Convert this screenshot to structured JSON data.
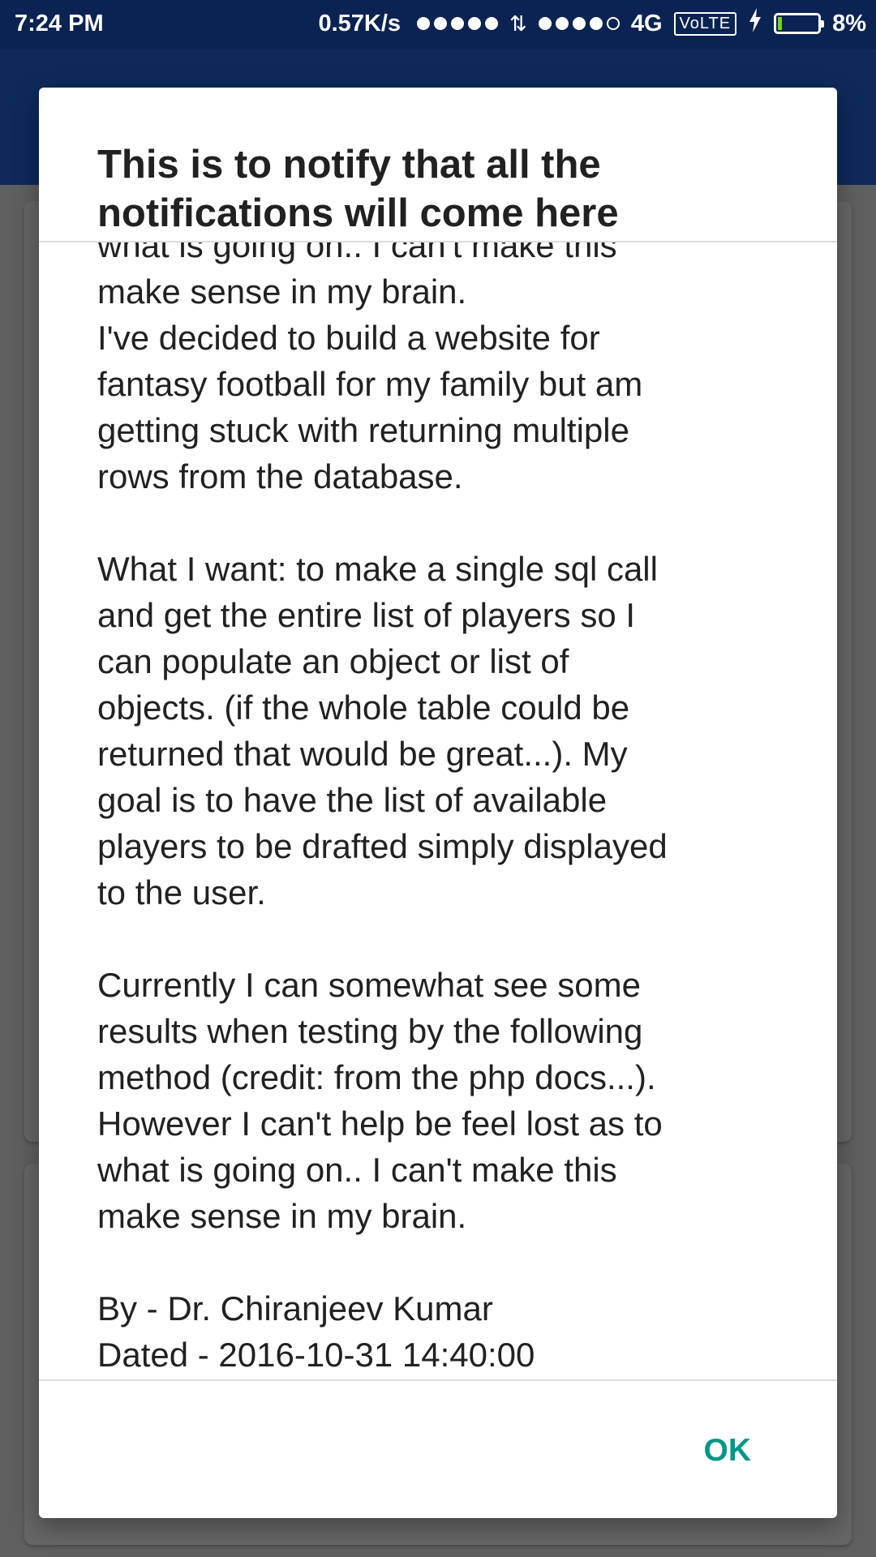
{
  "status_bar": {
    "time": "7:24 PM",
    "net_speed": "0.57K/s",
    "network_type": "4G",
    "volte": "VoLTE",
    "battery_percent": "8%",
    "signal_icon": "signal-dots-icon",
    "battery_icon": "battery-charging-icon"
  },
  "dialog": {
    "title": "This is to notify that all the notifications will come here",
    "body": "what is going on.. I can't make this\nmake sense in my brain.\nI've decided to build a website for\nfantasy football for my family but am\ngetting stuck with returning multiple\nrows from the database.\n\nWhat I want: to make a single sql call\nand get the entire list of players so I\ncan populate an object or list of\nobjects. (if the whole table could be\nreturned that would be great...). My\ngoal is to have the list of available\nplayers to be drafted simply displayed\nto the user.\n\nCurrently I can somewhat see some\nresults when testing by the following\nmethod (credit: from the php docs...).\nHowever I can't help be feel lost as to\nwhat is going on.. I can't make this\nmake sense in my brain.\n\nBy - Dr. Chiranjeev Kumar\nDated - 2016-10-31 14:40:00",
    "ok_label": "OK"
  },
  "colors": {
    "status_bar_bg": "#0a2352",
    "accent": "#009688",
    "scrim": "#5f5f5f"
  }
}
